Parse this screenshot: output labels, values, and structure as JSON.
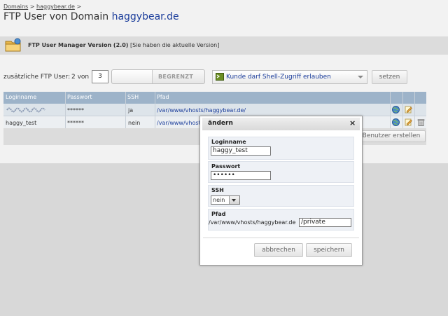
{
  "breadcrumb": {
    "root": "Domains",
    "sep1": ">",
    "domain": "haggybear.de",
    "sep2": ">"
  },
  "title": {
    "prefix": "FTP User von Domain",
    "domain": "haggybear.de"
  },
  "version": {
    "label": "FTP User Manager Version (2.0)",
    "note": "[Sie haben die aktuelle Version]"
  },
  "controls": {
    "extra_label": "zusätzliche FTP User:",
    "of_label": "2 von",
    "count_value": "3",
    "slider_label": "BEGRENZT",
    "shell_option": "Kunde darf Shell-Zugriff erlauben",
    "set_label": "setzen"
  },
  "table": {
    "columns": [
      "Loginname",
      "Passwort",
      "SSH",
      "Pfad"
    ],
    "rows": [
      {
        "login": "",
        "password": "******",
        "ssh": "ja",
        "path": "/var/www/vhosts/haggybear.de/"
      },
      {
        "login": "haggy_test",
        "password": "******",
        "ssh": "nein",
        "path": "/var/www/vhosts/"
      }
    ],
    "new_user_label": "Benutzer erstellen"
  },
  "dialog": {
    "title": "ändern",
    "close": "×",
    "login_label": "Loginname",
    "login_value": "haggy_test",
    "password_label": "Passwort",
    "password_value": "••••••",
    "ssh_label": "SSH",
    "ssh_value": "nein",
    "path_label": "Pfad",
    "path_prefix": "/var/www/vhosts/haggybear.de",
    "path_value": "/private",
    "cancel_label": "abbrechen",
    "save_label": "speichern"
  },
  "colors": {
    "header": "#9db3c9",
    "link": "#1b3d9b",
    "overlay": "#d8d8d8"
  },
  "icons": [
    "folder-icon",
    "shell-icon",
    "globe-icon",
    "edit-icon",
    "trash-icon",
    "close-icon",
    "chevron-down-icon"
  ]
}
